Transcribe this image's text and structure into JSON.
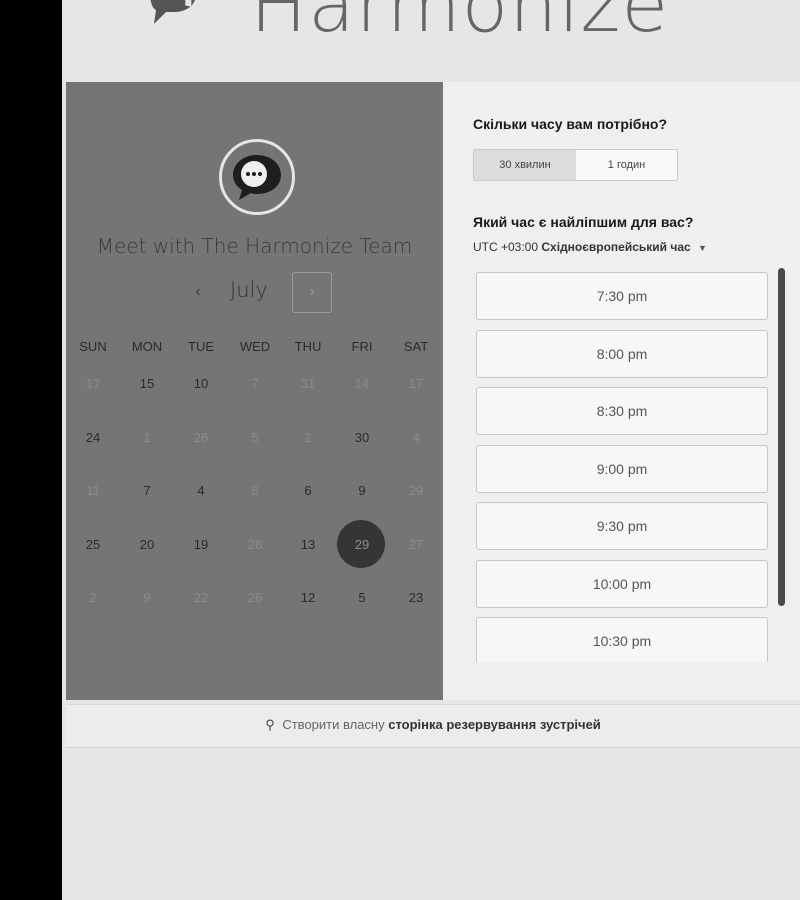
{
  "brand": {
    "name": "Harmonize"
  },
  "meeting": {
    "title": "Meet with The Harmonize Team"
  },
  "calendar": {
    "month": "July",
    "prev_label": "‹",
    "next_label": "›",
    "weekdays": [
      "SUN",
      "MON",
      "TUE",
      "WED",
      "THU",
      "FRI",
      "SAT"
    ],
    "weeks": [
      [
        {
          "d": "17",
          "s": "off"
        },
        {
          "d": "15",
          "s": "on"
        },
        {
          "d": "10",
          "s": "on"
        },
        {
          "d": "7",
          "s": "off"
        },
        {
          "d": "31",
          "s": "off"
        },
        {
          "d": "14",
          "s": "off"
        },
        {
          "d": "17",
          "s": "off"
        }
      ],
      [
        {
          "d": "24",
          "s": "on"
        },
        {
          "d": "1",
          "s": "off"
        },
        {
          "d": "26",
          "s": "off"
        },
        {
          "d": "5",
          "s": "off"
        },
        {
          "d": "2",
          "s": "off"
        },
        {
          "d": "30",
          "s": "on"
        },
        {
          "d": "4",
          "s": "off"
        }
      ],
      [
        {
          "d": "11",
          "s": "off"
        },
        {
          "d": "7",
          "s": "on"
        },
        {
          "d": "4",
          "s": "on"
        },
        {
          "d": "8",
          "s": "off"
        },
        {
          "d": "6",
          "s": "on"
        },
        {
          "d": "9",
          "s": "on"
        },
        {
          "d": "29",
          "s": "off"
        }
      ],
      [
        {
          "d": "25",
          "s": "on"
        },
        {
          "d": "20",
          "s": "on"
        },
        {
          "d": "19",
          "s": "on"
        },
        {
          "d": "28",
          "s": "off"
        },
        {
          "d": "13",
          "s": "on"
        },
        {
          "d": "29",
          "s": "sel"
        },
        {
          "d": "27",
          "s": "off"
        }
      ],
      [
        {
          "d": "2",
          "s": "off"
        },
        {
          "d": "9",
          "s": "off"
        },
        {
          "d": "22",
          "s": "off"
        },
        {
          "d": "26",
          "s": "off"
        },
        {
          "d": "12",
          "s": "on"
        },
        {
          "d": "5",
          "s": "on"
        },
        {
          "d": "23",
          "s": "on"
        }
      ]
    ]
  },
  "booking": {
    "duration_question": "Скільки часу вам потрібно?",
    "durations": [
      "30 хвилин",
      "1 годин"
    ],
    "time_question": "Який час є найліпшим для вас?",
    "timezone_offset": "UTC +03:00",
    "timezone_name": "Східноєвропейський час",
    "slots": [
      "7:30 pm",
      "8:00 pm",
      "8:30 pm",
      "9:00 pm",
      "9:30 pm",
      "10:00 pm",
      "10:30 pm"
    ]
  },
  "footer": {
    "prefix": "Створити власну",
    "link": "сторінка резервування зустрічей"
  }
}
